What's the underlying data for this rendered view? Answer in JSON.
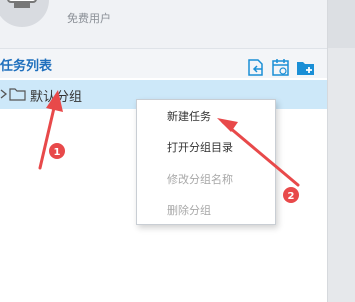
{
  "header": {
    "user_type": "免费用户"
  },
  "task_panel": {
    "title": "任务列表",
    "toolbar": [
      "import-task-icon",
      "schedule-task-icon",
      "new-group-icon"
    ],
    "groups": [
      {
        "label": "默认分组"
      }
    ]
  },
  "context_menu": {
    "items": [
      {
        "label": "新建任务",
        "enabled": true
      },
      {
        "label": "打开分组目录",
        "enabled": true
      },
      {
        "label": "修改分组名称",
        "enabled": false
      },
      {
        "label": "删除分组",
        "enabled": false
      }
    ]
  },
  "annotations": {
    "badges": [
      "1",
      "2"
    ],
    "color": "#e8494a"
  }
}
